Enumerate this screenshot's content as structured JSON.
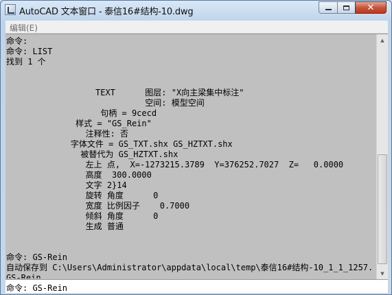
{
  "window": {
    "title": "AutoCAD 文本窗口 - 泰信16#结构-10.dwg"
  },
  "menu": {
    "edit_label": "编辑(E)"
  },
  "history": {
    "text": "命令:\n命令: LIST\n找到 1 个\n\n\n                  TEXT      图层: \"X向主梁集中标注\"\n                            空间: 模型空间\n                   句柄 = 9cecd\n              样式 = \"GS_Rein\"\n                注释性: 否\n             字体文件 = GS_TXT.shx GS_HZTXT.shx\n               被替代为 GS_HZTXT.shx\n                左上 点,  X=-1273215.3789  Y=376252.7027  Z=   0.0000\n                高度  300.0000\n                文字 2}14\n                旋转 角度      0\n                宽度 比例因子    0.7000\n                倾斜 角度      0\n                生成 普通\n\n\n命令: GS-Rein\n自动保存到 C:\\Users\\Administrator\\appdata\\local\\temp\\泰信16#结构-10_1_1_1257.\nGS-Rein\n命令: GS-Rein"
  },
  "command_line": {
    "text": "命令: GS-Rein"
  },
  "icons": {
    "app": "autocad-icon",
    "minimize": "minimize-icon",
    "maximize": "maximize-icon",
    "close": "close-icon"
  }
}
